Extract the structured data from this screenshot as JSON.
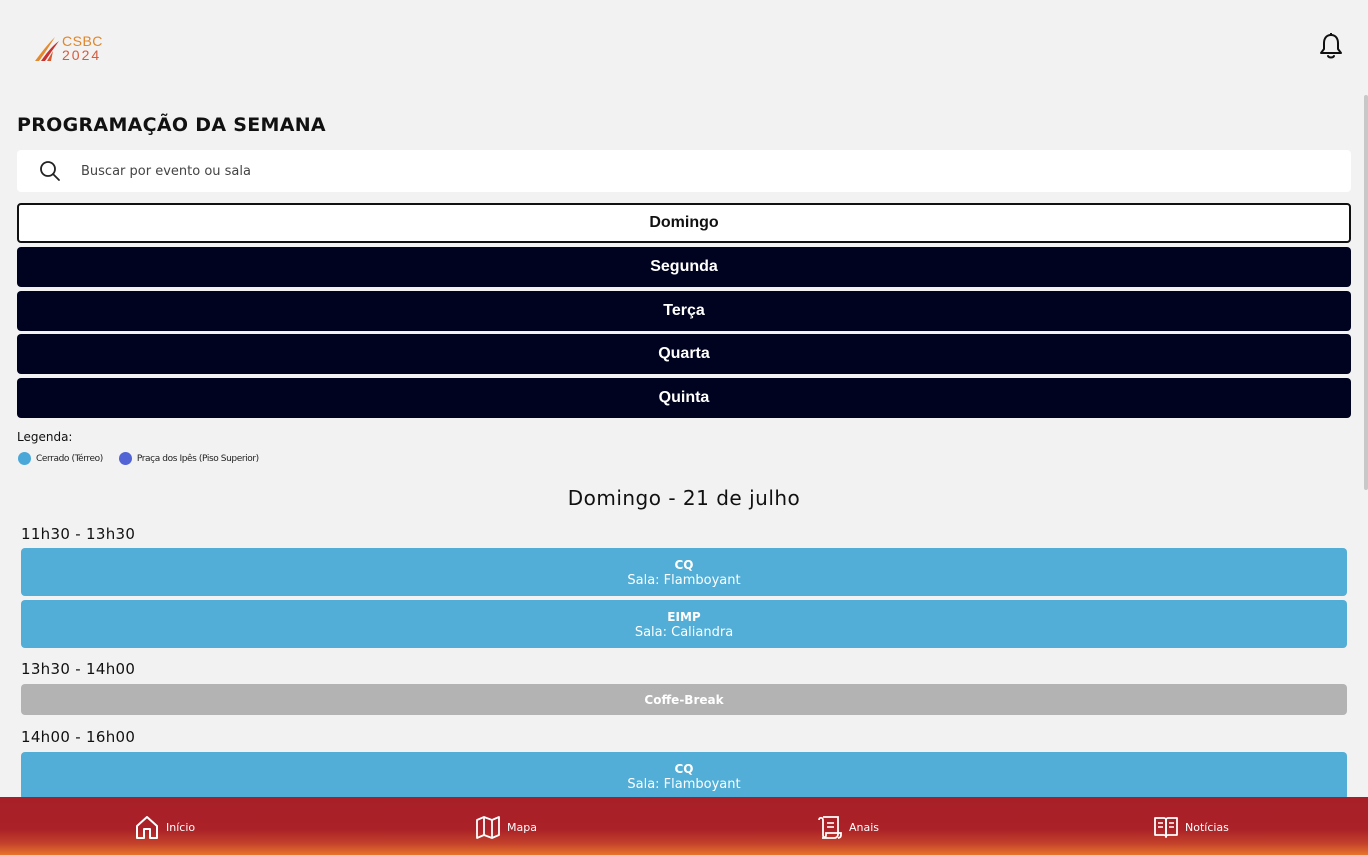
{
  "header": {
    "logo_line1": "CSBC",
    "logo_line2": "2024",
    "bell_icon": "bell-icon"
  },
  "page_title": "PROGRAMAÇÃO DA SEMANA",
  "search": {
    "placeholder": "Buscar por evento ou sala",
    "value": ""
  },
  "days": [
    {
      "label": "Domingo",
      "active": true
    },
    {
      "label": "Segunda",
      "active": false
    },
    {
      "label": "Terça",
      "active": false
    },
    {
      "label": "Quarta",
      "active": false
    },
    {
      "label": "Quinta",
      "active": false
    }
  ],
  "legend": {
    "title": "Legenda:",
    "items": [
      {
        "label": "Cerrado (Térreo)",
        "color": "#4aa8d8"
      },
      {
        "label": "Praça dos Ipês (Piso Superior)",
        "color": "#5263d6"
      }
    ]
  },
  "schedule": {
    "heading": "Domingo - 21 de julho",
    "slots": [
      {
        "time": "11h30 - 13h30",
        "events": [
          {
            "name": "CQ",
            "room": "Sala: Flamboyant"
          },
          {
            "name": "EIMP",
            "room": "Sala: Caliandra"
          }
        ]
      },
      {
        "time": "13h30 - 14h00",
        "events": [
          {
            "name": "Coffe-Break"
          }
        ]
      },
      {
        "time": "14h00 - 16h00",
        "events": [
          {
            "name": "CQ",
            "room": "Sala: Flamboyant"
          }
        ]
      }
    ]
  },
  "bottom_nav": [
    {
      "label": "Início",
      "icon": "home-icon"
    },
    {
      "label": "Mapa",
      "icon": "map-icon"
    },
    {
      "label": "Anais",
      "icon": "scroll-icon"
    },
    {
      "label": "Notícias",
      "icon": "book-icon"
    }
  ],
  "colors": {
    "cerrado": "#52aed6",
    "break": "#b3b3b3",
    "day_button": "#00031f",
    "nav_red": "#aa2127",
    "nav_orange": "#e8742b"
  }
}
